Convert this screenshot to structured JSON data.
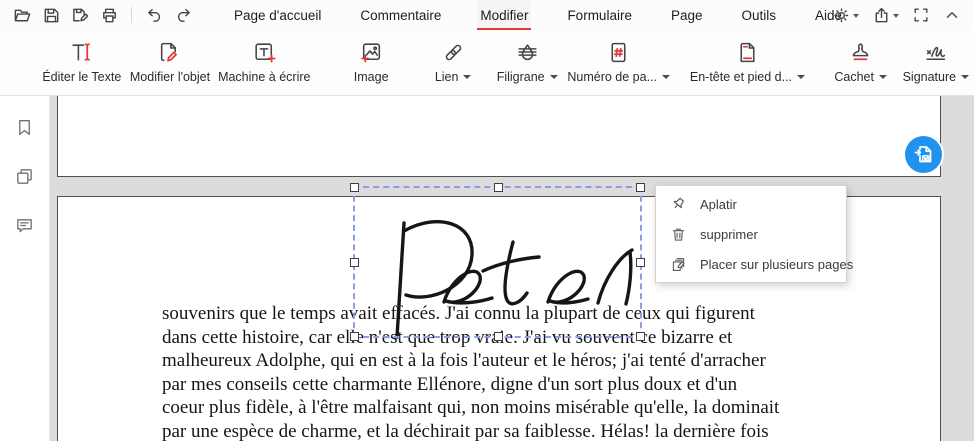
{
  "menubar": {
    "quick_icons": [
      "open",
      "save",
      "save-as",
      "print",
      "undo",
      "redo"
    ],
    "tabs": [
      "Page d'accueil",
      "Commentaire",
      "Modifier",
      "Formulaire",
      "Page",
      "Outils",
      "Aide"
    ],
    "active_tab": "Modifier",
    "right_icons": [
      "theme-brightness",
      "share",
      "fullscreen",
      "collapse-toolbar"
    ]
  },
  "toolbar": {
    "buttons": [
      {
        "label": "Éditer le Texte",
        "icon": "edit-text-icon",
        "dropdown": false
      },
      {
        "label": "Modifier l'objet",
        "icon": "modify-object-icon",
        "dropdown": false
      },
      {
        "label": "Machine à écrire",
        "icon": "typewriter-icon",
        "dropdown": false
      },
      {
        "label": "Image",
        "icon": "image-icon",
        "dropdown": false
      },
      {
        "label": "Lien",
        "icon": "link-icon",
        "dropdown": true
      },
      {
        "label": "Filigrane",
        "icon": "watermark-icon",
        "dropdown": true
      },
      {
        "label": "Numéro de pa...",
        "icon": "page-number-icon",
        "dropdown": true
      },
      {
        "label": "En-tête et pied d...",
        "icon": "header-footer-icon",
        "dropdown": true
      },
      {
        "label": "Cachet",
        "icon": "stamp-icon",
        "dropdown": true
      },
      {
        "label": "Signature",
        "icon": "signature-icon",
        "dropdown": true
      }
    ]
  },
  "sidebar": {
    "icons": [
      "bookmarks",
      "page-thumbnails",
      "comments"
    ]
  },
  "document": {
    "signature": "Peter",
    "lines": [
      "souvenirs que le temps avait effacés. J'ai connu la plupart de ceux qui figurent",
      "dans cette histoire, car elle n'est que trop vraie. J'ai vu souvent ce bizarre et",
      "malheureux Adolphe, qui en est à la fois l'auteur et le héros; j'ai tenté d'arracher",
      "par mes conseils cette charmante Ellénore, digne d'un sort plus doux et d'un",
      "coeur plus fidèle, à l'être malfaisant qui, non moins misérable qu'elle, la dominait",
      "par une espèce de charme, et la déchirait par sa faiblesse. Hélas! la dernière fois"
    ]
  },
  "context_menu": {
    "items": [
      {
        "label": "Aplatir",
        "icon": "flatten-pin-icon"
      },
      {
        "label": "supprimer",
        "icon": "trash-icon"
      },
      {
        "label": "Placer sur plusieurs pages",
        "icon": "multi-pages-icon"
      }
    ]
  },
  "floating_button": {
    "name": "convert-to-word",
    "color": "#2193ee"
  },
  "colors": {
    "accent_red": "#e23c39",
    "selection_blue": "#8d9ce5",
    "canvas_gray": "#dcdcdc"
  }
}
